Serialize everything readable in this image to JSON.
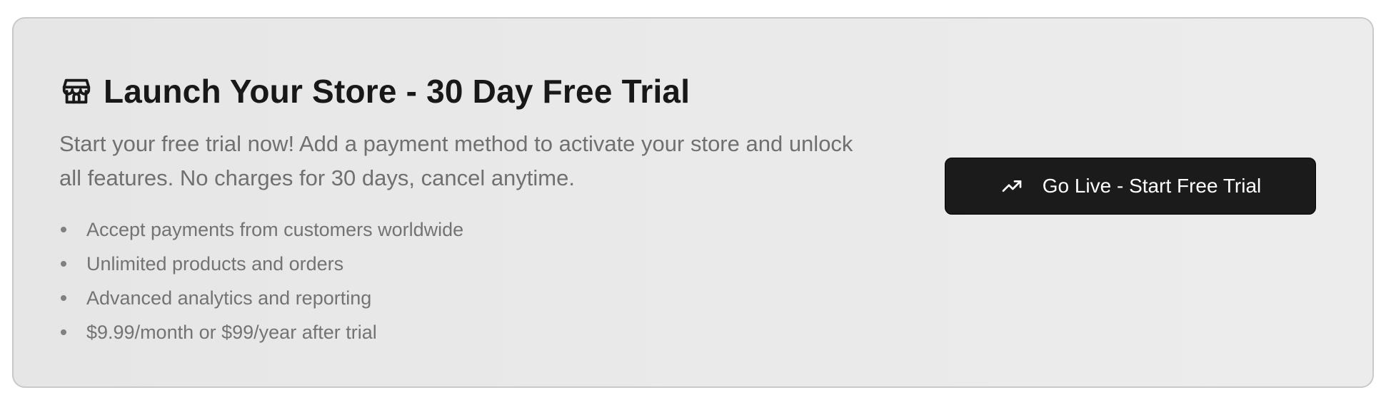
{
  "banner": {
    "icon": "store-icon",
    "title": "Launch Your Store - 30 Day Free Trial",
    "description": "Start your free trial now! Add a payment method to activate your store and unlock all features. No charges for 30 days, cancel anytime.",
    "features": [
      "Accept payments from customers worldwide",
      "Unlimited products and orders",
      "Advanced analytics and reporting",
      "$9.99/month or $99/year after trial"
    ],
    "cta": {
      "icon": "trending-up-icon",
      "label": "Go Live - Start Free Trial"
    }
  },
  "colors": {
    "card_background": "#e8e8e8",
    "title_text": "#181818",
    "muted_text": "#707070",
    "button_background": "#1b1b1b",
    "button_text": "#ffffff"
  }
}
